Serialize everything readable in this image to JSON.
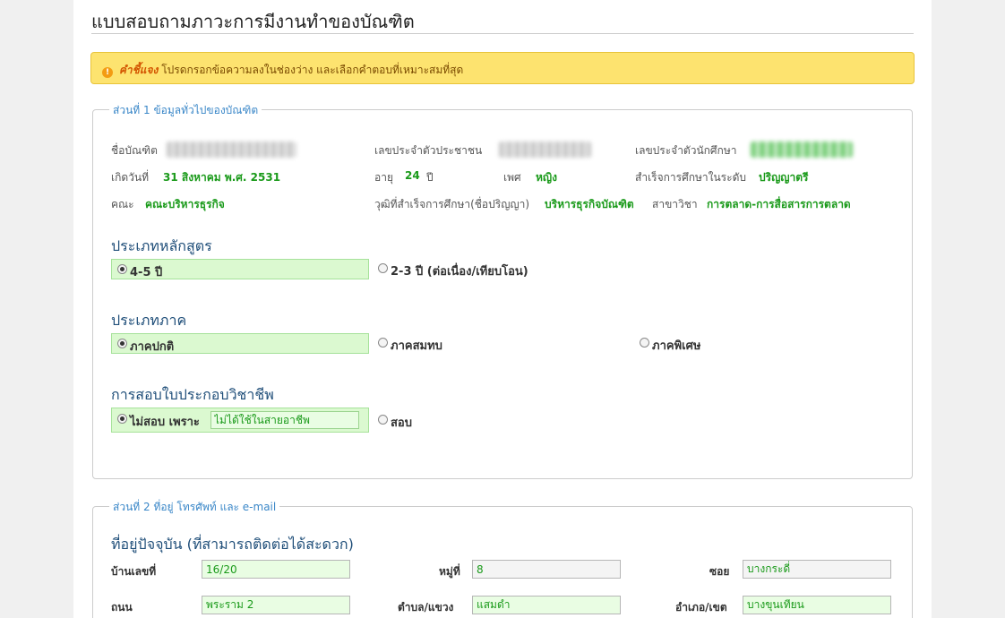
{
  "page_title": "แบบสอบถามภาวะการมีงานทำของบัณฑิต",
  "notice": {
    "icon": "exclamation-icon",
    "strong": "คำชี้แจง",
    "text": "โปรดกรอกข้อความลงในช่องว่าง และเลือกคำตอบที่เหมาะสมที่สุด"
  },
  "section1": {
    "legend": "ส่วนที่ 1 ข้อมูลทั่วไปของบัณฑิต",
    "name_label": "ชื่อบัณฑิต",
    "citizen_id_label": "เลขประจำตัวประชาชน",
    "student_id_label": "เลขประจำตัวนักศึกษา",
    "birth_label": "เกิดวันที่",
    "birth_value": "31 สิงหาคม พ.ศ. 2531",
    "age_label": "อายุ",
    "age_value": "24",
    "age_unit": "ปี",
    "gender_label": "เพศ",
    "gender_value": "หญิง",
    "level_label": "สำเร็จการศึกษาในระดับ",
    "level_value": "ปริญญาตรี",
    "faculty_label": "คณะ",
    "faculty_value": "คณะบริหารธุรกิจ",
    "degree_label": "วุฒิที่สำเร็จการศึกษา(ชื่อปริญญา)",
    "degree_value": "บริหารธุรกิจบัณฑิต",
    "major_label": "สาขาวิชา",
    "major_value": "การตลาด-การสื่อสารการตลาด",
    "curriculum": {
      "heading": "ประเภทหลักสูตร",
      "options": [
        "4-5 ปี",
        "2-3 ปี (ต่อเนื่อง/เทียบโอน)"
      ]
    },
    "program": {
      "heading": "ประเภทภาค",
      "options": [
        "ภาคปกติ",
        "ภาคสมทบ",
        "ภาคพิเศษ"
      ]
    },
    "license": {
      "heading": "การสอบใบประกอบวิชาชีพ",
      "option_no": "ไม่สอบ เพราะ",
      "reason_value": "ไม่ได้ใช้ในสายอาชีพ",
      "option_yes": "สอบ"
    }
  },
  "section2": {
    "legend": "ส่วนที่ 2 ที่อยู่ โทรศัพท์ และ e-mail",
    "heading": "ที่อยู่ปัจจุบัน (ที่สามารถติดต่อได้สะดวก)",
    "house_no_label": "บ้านเลขที่",
    "house_no_value": "16/20",
    "moo_label": "หมู่ที่",
    "moo_value": "8",
    "soi_label": "ซอย",
    "soi_value": "บางกระดี่",
    "road_label": "ถนน",
    "road_value": "พระราม 2",
    "subdistrict_label": "ตำบล/แขวง",
    "subdistrict_value": "แสมดำ",
    "district_label": "อำเภอ/เขต",
    "district_value": "บางขุนเทียน"
  }
}
